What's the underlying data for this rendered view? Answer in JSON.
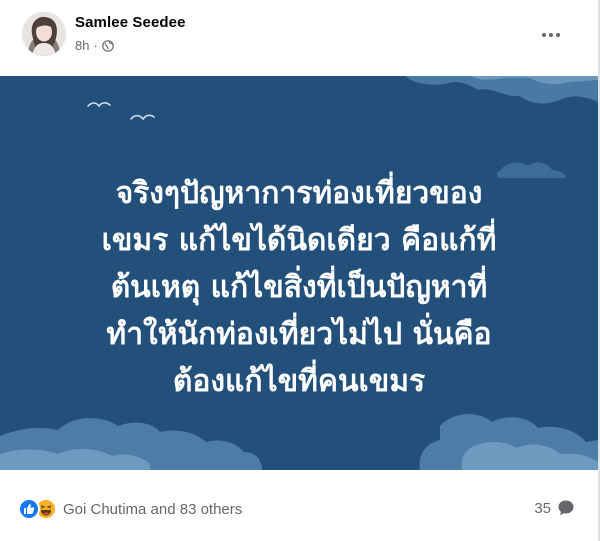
{
  "post": {
    "author": "Samlee Seedee",
    "time": "8h",
    "separator": "·",
    "privacy_icon": "globe-icon",
    "more_icon": "more-horizontal-icon"
  },
  "image": {
    "background_color": "#23507a",
    "text_lines": [
      "จริงๆปัญหาการท่องเที่ยวของ",
      "เขมร แก้ไขได้นิดเดียว คือแก้ที่",
      "ต้นเหตุ แก้ไขสิ่งที่เป็นปัญหาที่",
      "ทำให้นักท่องเที่ยวไม่ไป นั่นคือ",
      "ต้องแก้ไขที่คนเขมร"
    ]
  },
  "footer": {
    "reaction_icons": [
      "like-icon",
      "haha-icon"
    ],
    "reactions_label": "Goi Chutima and 83 others",
    "comments_count": "35",
    "comment_icon": "comment-icon"
  },
  "colors": {
    "like": "#1877f2",
    "haha": "#f7b125",
    "muted_text": "#65676b"
  }
}
